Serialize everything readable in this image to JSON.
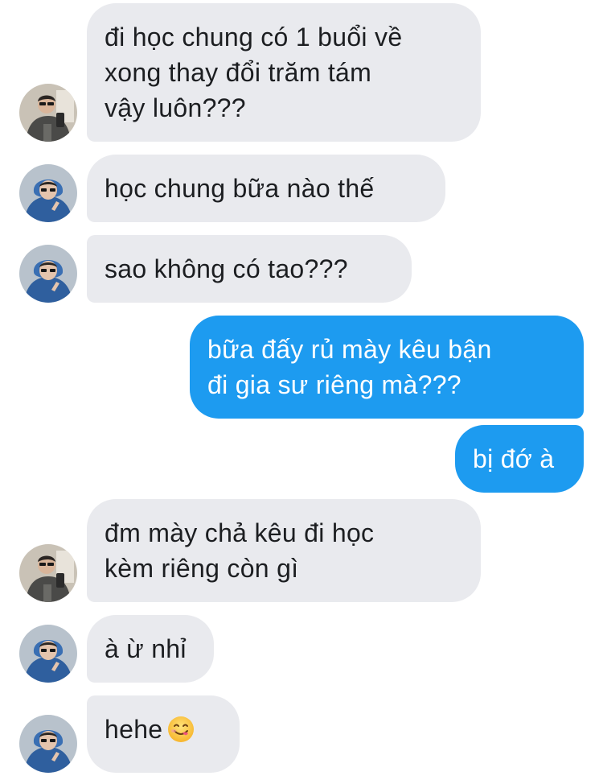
{
  "messages": [
    {
      "direction": "incoming",
      "sender_avatar": "avatar-jacket-guy",
      "lines": [
        "đi học chung có 1 buổi về",
        "xong thay đổi trăm tám",
        "vậy luôn???"
      ]
    },
    {
      "direction": "incoming",
      "sender_avatar": "avatar-blue-hoodie-girl",
      "lines": [
        "học chung bữa nào thế"
      ]
    },
    {
      "direction": "incoming",
      "sender_avatar": "avatar-blue-hoodie-girl",
      "lines": [
        "sao không có tao???"
      ]
    },
    {
      "direction": "outgoing",
      "lines": [
        "bữa đấy rủ mày kêu bận",
        "đi gia sư riêng mà???"
      ]
    },
    {
      "direction": "outgoing",
      "lines": [
        "bị đớ à"
      ]
    },
    {
      "direction": "incoming",
      "sender_avatar": "avatar-jacket-guy",
      "lines": [
        "đm mày chả kêu đi học",
        "kèm riêng còn gì"
      ]
    },
    {
      "direction": "incoming",
      "sender_avatar": "avatar-blue-hoodie-girl",
      "lines": [
        "à ừ nhỉ"
      ]
    },
    {
      "direction": "incoming",
      "sender_avatar": "avatar-blue-hoodie-girl",
      "lines": [
        "hehe"
      ],
      "emoji": "yum-face-emoji"
    }
  ],
  "colors": {
    "incoming_bubble": "#e9eaee",
    "outgoing_bubble": "#1d9bf0",
    "incoming_text": "#1c1e21",
    "outgoing_text": "#ffffff",
    "background": "#ffffff"
  }
}
